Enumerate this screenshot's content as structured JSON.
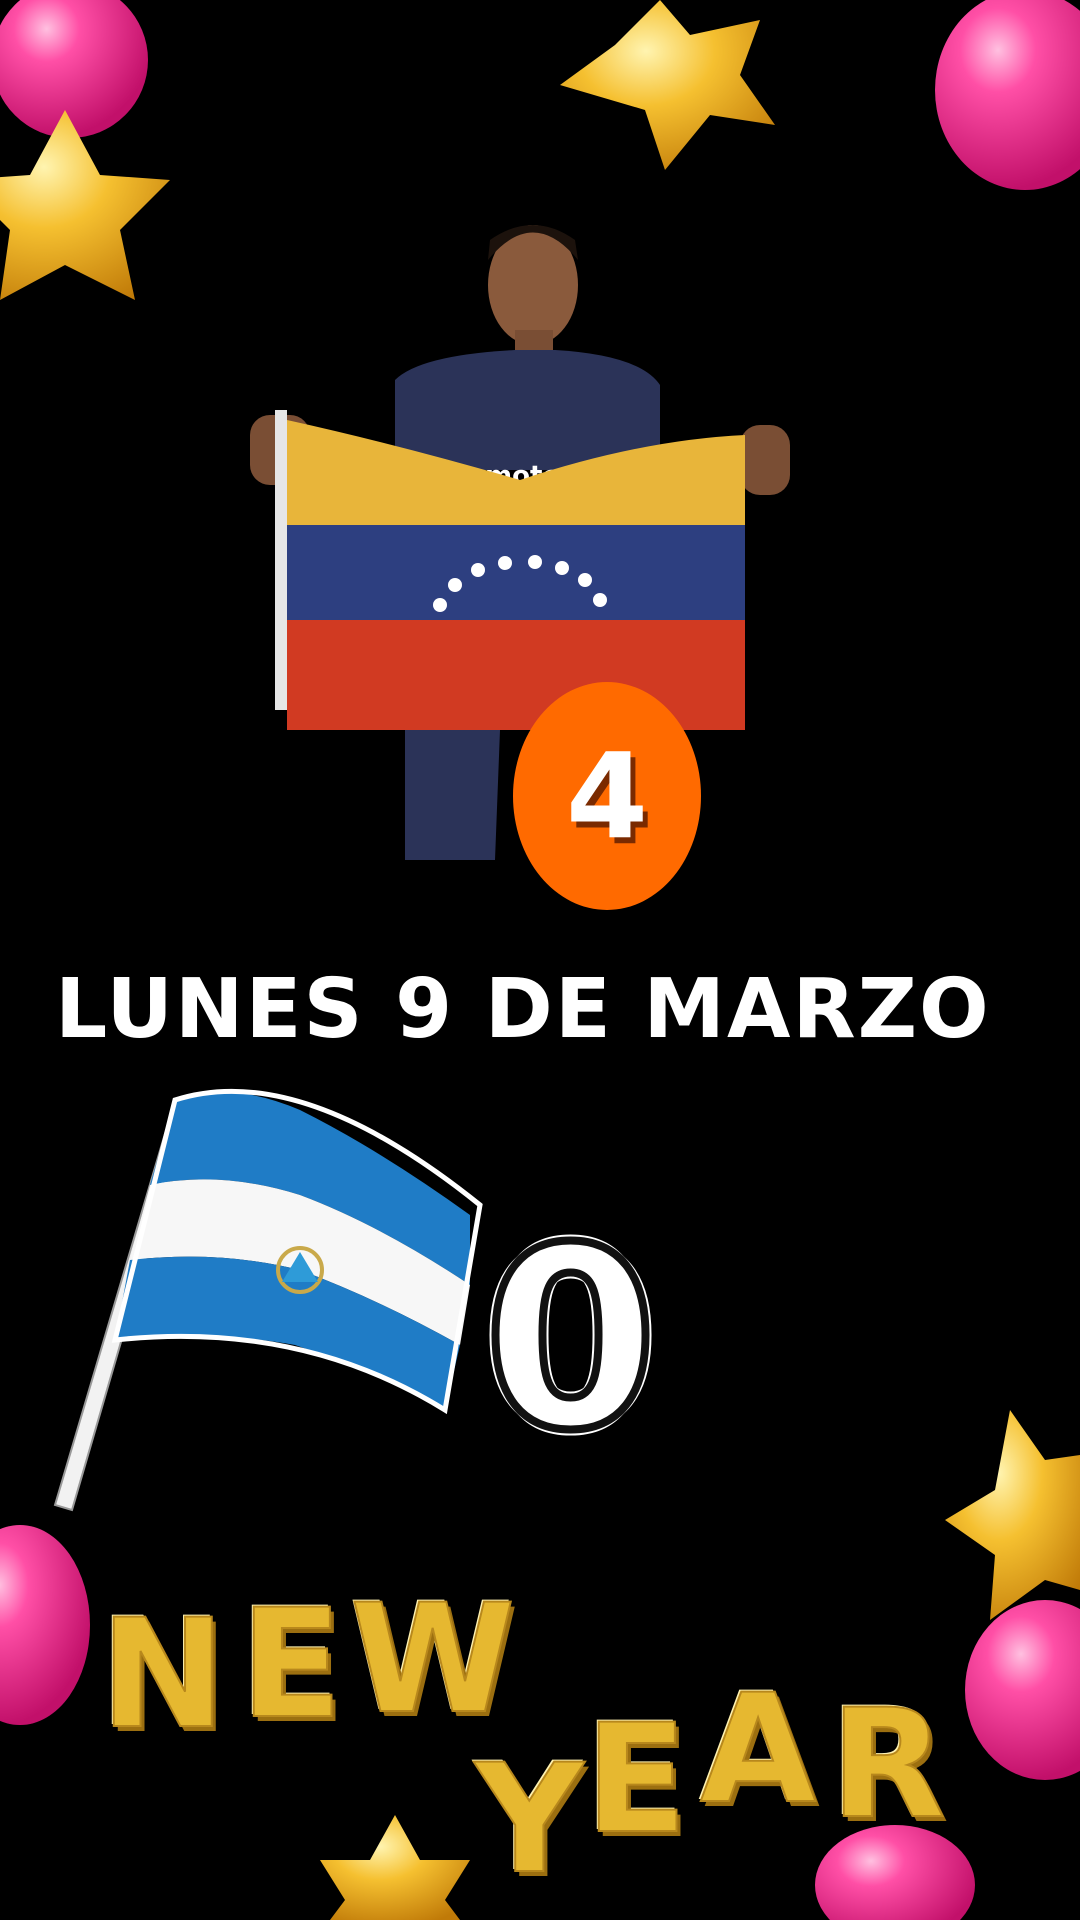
{
  "date_text": "LUNES 9 DE MARZO",
  "scores": {
    "top": "4",
    "bottom": "0"
  },
  "new_year": {
    "word1": [
      "N",
      "E",
      "W"
    ],
    "word2": [
      "Y",
      "E",
      "A",
      "R"
    ]
  },
  "player": {
    "shirt_sponsor": "motorola"
  },
  "colors": {
    "background": "#000000",
    "badge": "#ff6a00",
    "balloon_pink": "#ff2e8f",
    "star_gold": "#f5b81c",
    "venezuela_yellow": "#e8b53a",
    "venezuela_blue": "#2d3f80",
    "venezuela_red": "#d13a22",
    "nicaragua_blue": "#1f7cc6",
    "gold_letters": "#e6b830"
  },
  "icons": [
    "balloon-icon",
    "star-balloon-icon",
    "venezuela-flag-icon",
    "nicaragua-flag-icon"
  ]
}
